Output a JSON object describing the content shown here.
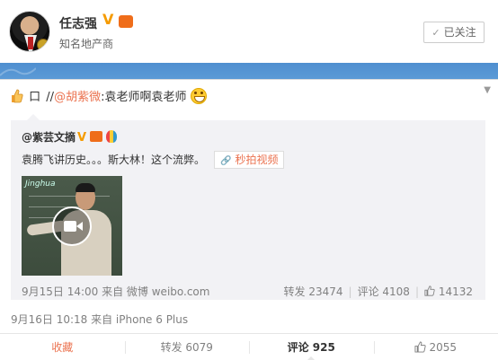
{
  "profile": {
    "name": "任志强",
    "verify_badge": "V",
    "vip_badge": "ᯤ",
    "description": "知名地产商",
    "follow_check": "✓",
    "follow_label": "已关注"
  },
  "post": {
    "box_char": "口",
    "repost_prefix": "//",
    "mention": "@胡紫微",
    "repost_text": ":袁老师啊袁老师",
    "original": {
      "user": "@紫芸文摘",
      "verify_badge": "V",
      "text": "袁腾飞讲历史。。。斯大林！这个流弊。",
      "video_tag": "秒拍视频",
      "video_logo": "Jinghua",
      "time_source": "9月15日 14:00 来自 微博 weibo.com",
      "repost": "转发 23474",
      "comment": "评论 4108",
      "like": "14132"
    },
    "time_source": "9月16日 10:18 来自 iPhone 6 Plus"
  },
  "actions": {
    "collect": "收藏",
    "repost": "转发 6079",
    "comment": "评论 925",
    "like": "2055"
  },
  "colors": {
    "accent": "#eb7350",
    "banner": "#5b9ad6",
    "muted": "#808080"
  }
}
